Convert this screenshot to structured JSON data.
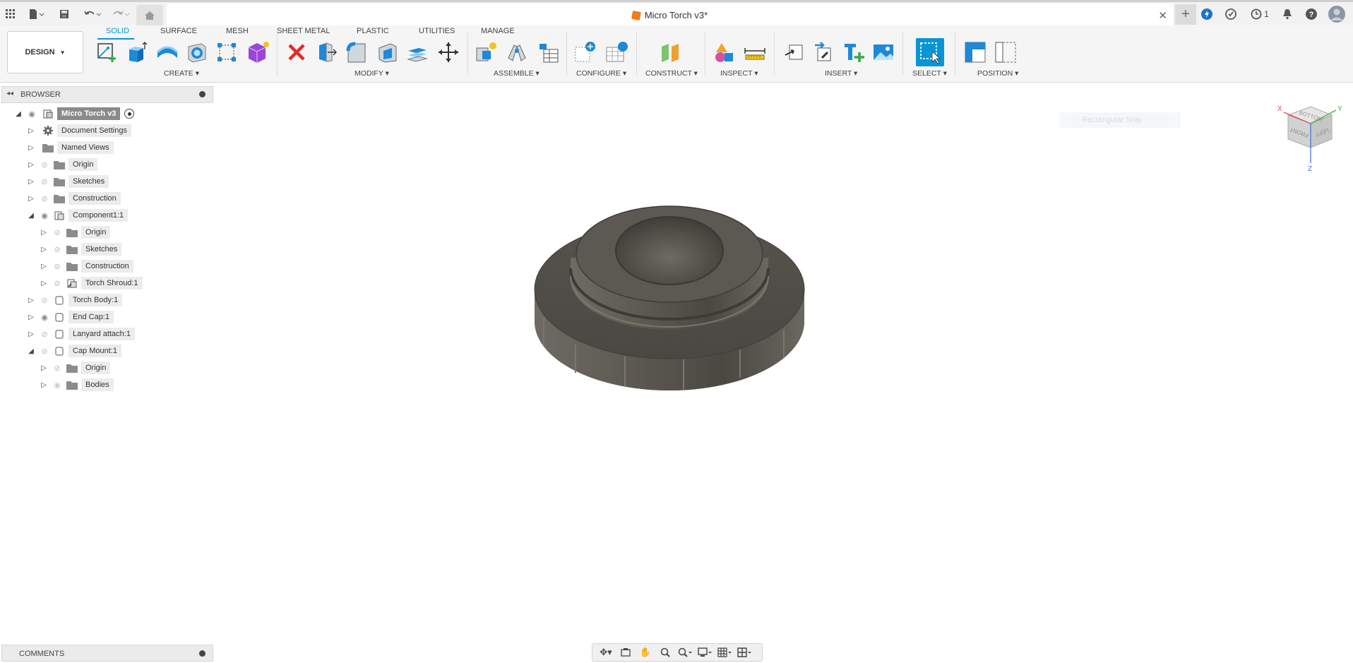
{
  "window": {
    "title": "Micro Torch v3*"
  },
  "titlebar": {
    "notifications_count": "1"
  },
  "workspace": {
    "label": "DESIGN"
  },
  "tabs": [
    {
      "label": "SOLID"
    },
    {
      "label": "SURFACE"
    },
    {
      "label": "MESH"
    },
    {
      "label": "SHEET METAL"
    },
    {
      "label": "PLASTIC"
    },
    {
      "label": "UTILITIES"
    },
    {
      "label": "MANAGE"
    }
  ],
  "groups": [
    {
      "label": "CREATE"
    },
    {
      "label": "MODIFY"
    },
    {
      "label": "ASSEMBLE"
    },
    {
      "label": "CONFIGURE"
    },
    {
      "label": "CONSTRUCT"
    },
    {
      "label": "INSPECT"
    },
    {
      "label": "INSERT"
    },
    {
      "label": "SELECT"
    },
    {
      "label": "POSITION"
    }
  ],
  "browser": {
    "title": "BROWSER",
    "root": "Micro Torch v3",
    "items": [
      {
        "label": "Document Settings"
      },
      {
        "label": "Named Views"
      },
      {
        "label": "Origin"
      },
      {
        "label": "Sketches"
      },
      {
        "label": "Construction"
      },
      {
        "label": "Component1:1"
      },
      {
        "label": "Origin"
      },
      {
        "label": "Sketches"
      },
      {
        "label": "Construction"
      },
      {
        "label": "Torch Shroud:1"
      },
      {
        "label": "Torch Body:1"
      },
      {
        "label": "End Cap:1"
      },
      {
        "label": "Lanyard attach:1"
      },
      {
        "label": "Cap Mount:1"
      },
      {
        "label": "Origin"
      },
      {
        "label": "Bodies"
      }
    ]
  },
  "viewport": {
    "ghost_label": "Rectangular Snip"
  },
  "viewcube": {
    "faces": [
      "BOTTOM",
      "FRONT",
      "LEFT"
    ],
    "axes": [
      "X",
      "Y",
      "Z"
    ]
  },
  "comments": {
    "title": "COMMENTS"
  },
  "colors": {
    "accent": "#0696d7",
    "part": "#5a574f"
  }
}
